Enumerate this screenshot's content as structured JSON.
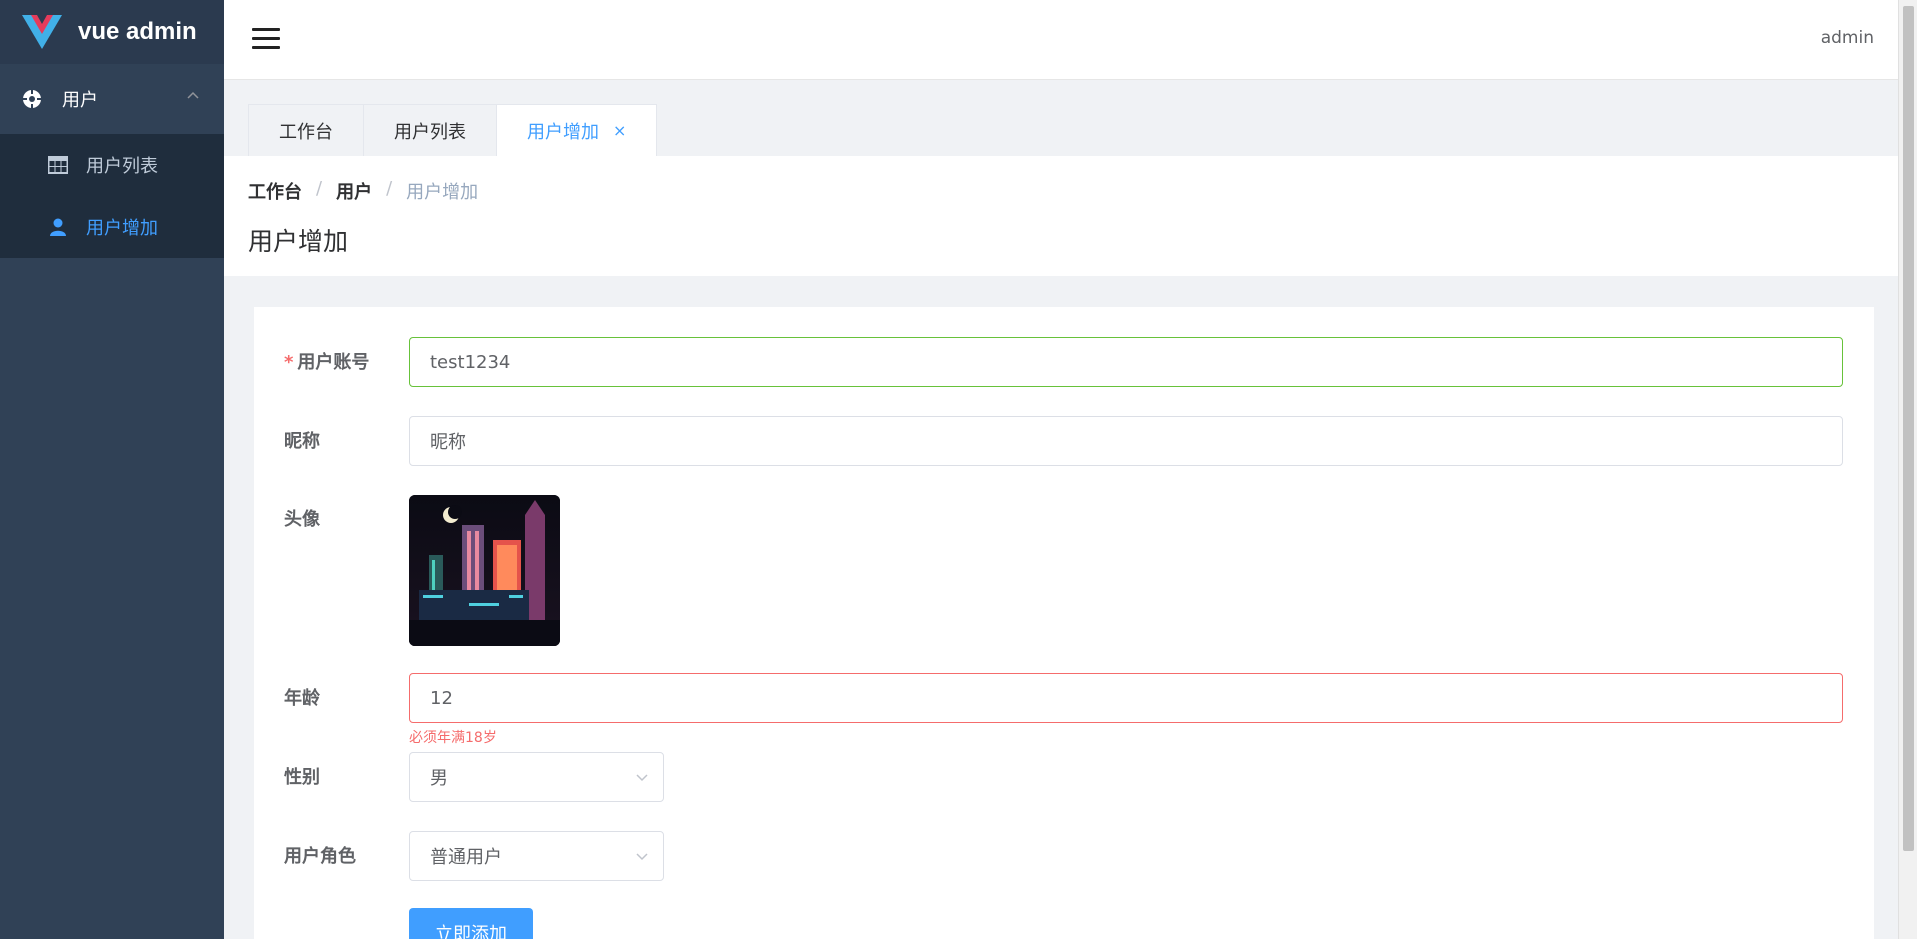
{
  "app": {
    "title": "vue admin"
  },
  "header": {
    "user": "admin"
  },
  "sidebar": {
    "parent_label": "用户",
    "items": [
      {
        "label": "用户列表",
        "icon": "table-icon"
      },
      {
        "label": "用户增加",
        "icon": "user-icon",
        "active": true
      }
    ]
  },
  "tabs": [
    {
      "label": "工作台"
    },
    {
      "label": "用户列表"
    },
    {
      "label": "用户增加",
      "active": true,
      "close": "×"
    }
  ],
  "breadcrumb": {
    "items": [
      "工作台",
      "用户",
      "用户增加"
    ],
    "separator": "/"
  },
  "page": {
    "title": "用户增加"
  },
  "form": {
    "required_mark": "*",
    "account": {
      "label": "用户账号",
      "value": "test1234"
    },
    "nickname": {
      "label": "昵称",
      "placeholder": "昵称"
    },
    "avatar": {
      "label": "头像"
    },
    "age": {
      "label": "年龄",
      "value": "12",
      "error": "必须年满18岁"
    },
    "gender": {
      "label": "性别",
      "value": "男"
    },
    "role": {
      "label": "用户角色",
      "value": "普通用户"
    },
    "submit_label": "立即添加"
  },
  "colors": {
    "primary": "#409eff",
    "sidebar": "#304156",
    "success": "#67c23a",
    "danger": "#f56c6c"
  }
}
